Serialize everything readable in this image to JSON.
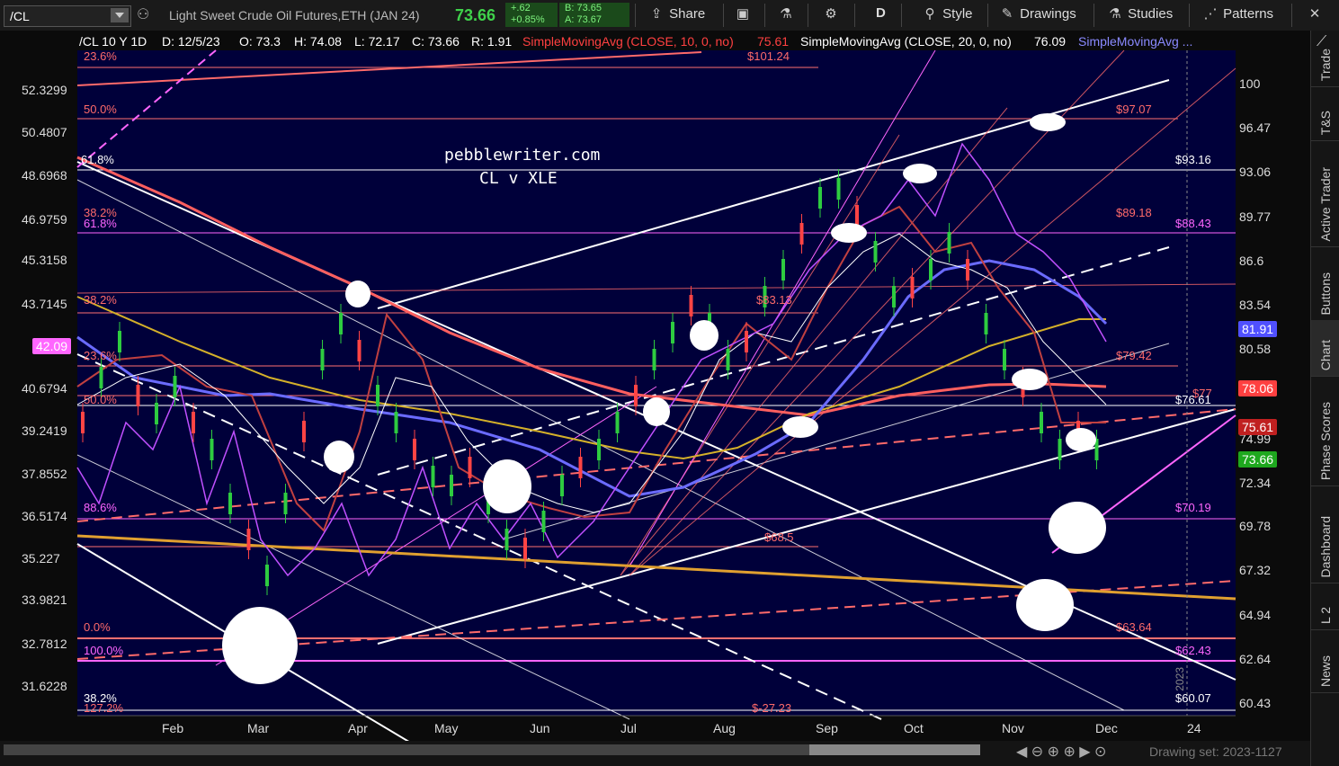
{
  "toolbar": {
    "symbol": "/CL",
    "title": "Light Sweet Crude Oil Futures,ETH (JAN 24)",
    "last": "73.66",
    "change": "+.62",
    "change_pct": "+0.85%",
    "bid": "B: 73.65",
    "ask": "A: 73.67",
    "share": "Share",
    "period": "D",
    "style": "Style",
    "drawings": "Drawings",
    "studies": "Studies",
    "patterns": "Patterns"
  },
  "header": {
    "desc": "/CL 10 Y 1D",
    "date": "D: 12/5/23",
    "open": "O: 73.3",
    "high": "H: 74.08",
    "low": "L: 72.17",
    "close": "C: 73.66",
    "range": "R: 1.91",
    "sma10": "SimpleMovingAvg (CLOSE, 10, 0, no)",
    "sma10_val": "75.61",
    "sma20": "SimpleMovingAvg (CLOSE, 20, 0, no)",
    "sma20_val": "76.09",
    "sma3": "SimpleMovingAvg ..."
  },
  "watermark": {
    "line1": "pebblewriter.com",
    "line2": "CL v XLE"
  },
  "left_axis": [
    "52.3299",
    "50.4807",
    "48.6968",
    "46.9759",
    "45.3158",
    "43.7145",
    "42.09",
    "40.6794",
    "39.2419",
    "37.8552",
    "36.5174",
    "35.227",
    "33.9821",
    "32.7812",
    "31.6228"
  ],
  "right_axis": [
    "100",
    "96.47",
    "93.06",
    "89.77",
    "86.6",
    "83.54",
    "80.58",
    "74.99",
    "72.34",
    "69.78",
    "67.32",
    "64.94",
    "62.64",
    "60.43"
  ],
  "x_axis": [
    "Feb",
    "Mar",
    "Apr",
    "May",
    "Jun",
    "Jul",
    "Aug",
    "Sep",
    "Oct",
    "Nov",
    "Dec",
    "24"
  ],
  "fib_left": [
    "23.6%",
    "50.0%",
    "61.8%",
    "38.2%",
    "61.8%",
    "38.2%",
    "23.6%",
    "50.0%",
    "88.6%",
    "0.0%",
    "100.0%",
    "38.2%",
    "127.2%"
  ],
  "price_tags": [
    "$101.24",
    "$97.07",
    "$93.16",
    "$89.18",
    "$88.43",
    "$83.13",
    "$79.42",
    "$77",
    "$76.61",
    "$70.19",
    "$68.5",
    "$63.64",
    "$62.43",
    "$60.07",
    "$-27.23"
  ],
  "pills": {
    "left": "42.09",
    "v1": "81.91",
    "v2": "78.06",
    "v3": "75.61",
    "v4": "73.66"
  },
  "right_tabs": [
    "Trade",
    "T&S",
    "Active Trader",
    "Buttons",
    "Chart",
    "Phase Scores",
    "Dashboard",
    "L 2",
    "News"
  ],
  "bottom": {
    "drawing_set": "Drawing set: 2023-1127",
    "year": "2023"
  },
  "colors": {
    "bg": "#00003a",
    "price_up": "#2ecc40",
    "price_down": "#ff4444",
    "sma_red": "#ff5f5f",
    "sma_blue": "#6b6bff",
    "sma_gold": "#d4b02a",
    "fib": "#ff6a6a",
    "magenta": "#ff66ff"
  }
}
